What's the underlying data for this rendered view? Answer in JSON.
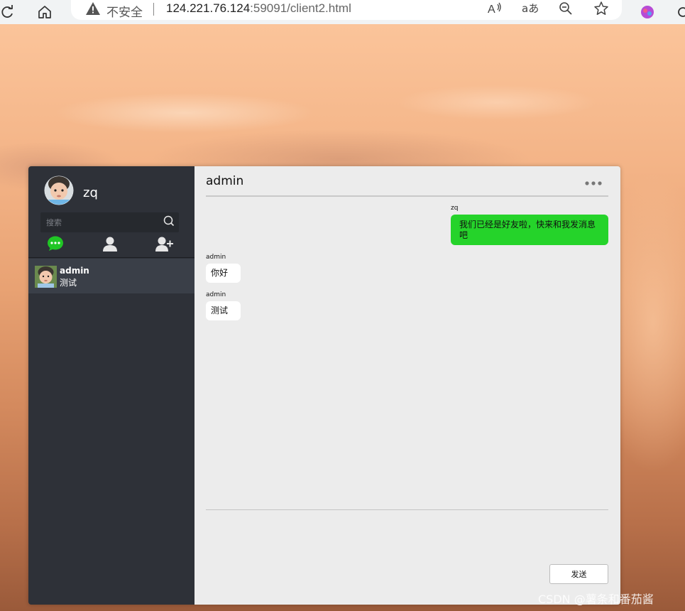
{
  "browser": {
    "security_label": "不安全",
    "url_host": "124.221.76.124",
    "url_rest": ":59091/client2.html",
    "icons": [
      "reload-icon",
      "home-icon",
      "warning-icon",
      "read-aloud-icon",
      "translate-icon",
      "zoom-out-icon",
      "favorite-star-icon",
      "extension-icon"
    ]
  },
  "user": {
    "name": "zq",
    "avatar": "baby-avatar"
  },
  "sidebar": {
    "search_placeholder": "搜索",
    "tabs": [
      {
        "name": "chats",
        "icon": "chat-bubble-icon",
        "active": true,
        "color": "#20c625"
      },
      {
        "name": "contacts",
        "icon": "user-icon",
        "active": false,
        "color": "#e6e6e6"
      },
      {
        "name": "add-friend",
        "icon": "add-user-icon",
        "active": false,
        "color": "#e6e6e6"
      }
    ],
    "contacts": [
      {
        "name": "admin",
        "preview": "测试",
        "avatar": "baby-avatar",
        "selected": true
      }
    ]
  },
  "chat": {
    "title": "admin",
    "messages": [
      {
        "sender": "zq",
        "text": "我们已经是好友啦，快来和我发消息吧",
        "mine": true
      },
      {
        "sender": "admin",
        "text": "你好",
        "mine": false
      },
      {
        "sender": "admin",
        "text": "测试",
        "mine": false
      }
    ],
    "send_label": "发送",
    "colors": {
      "mine_bubble": "#25d32a",
      "their_bubble": "#ffffff",
      "panel_bg": "#ececec",
      "sidebar_bg": "#2e3138"
    }
  },
  "watermark": "CSDN @薯条和番茄酱"
}
